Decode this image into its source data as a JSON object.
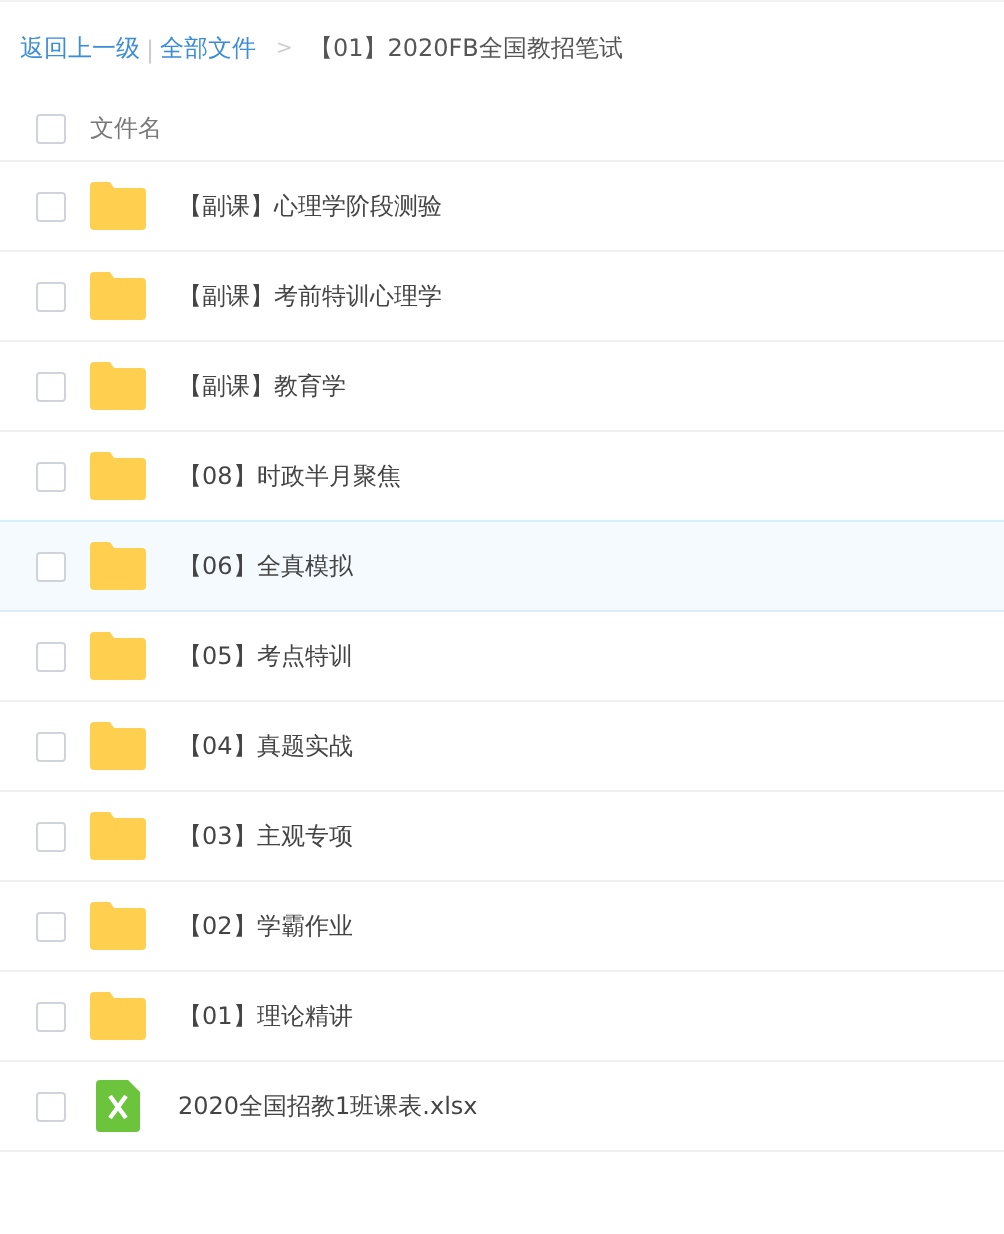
{
  "breadcrumb": {
    "back": "返回上一级",
    "separator": "|",
    "root": "全部文件",
    "arrow": ">",
    "current": "【01】2020FB全国教招笔试"
  },
  "header": {
    "label": "文件名",
    "checked": false
  },
  "files": [
    {
      "kind": "folder",
      "name": "【副课】心理学阶段测验",
      "checked": false,
      "hovered": false
    },
    {
      "kind": "folder",
      "name": "【副课】考前特训心理学",
      "checked": false,
      "hovered": false
    },
    {
      "kind": "folder",
      "name": "【副课】教育学",
      "checked": false,
      "hovered": false
    },
    {
      "kind": "folder",
      "name": "【08】时政半月聚焦",
      "checked": false,
      "hovered": false
    },
    {
      "kind": "folder",
      "name": "【06】全真模拟",
      "checked": false,
      "hovered": true
    },
    {
      "kind": "folder",
      "name": "【05】考点特训",
      "checked": false,
      "hovered": false
    },
    {
      "kind": "folder",
      "name": "【04】真题实战",
      "checked": false,
      "hovered": false
    },
    {
      "kind": "folder",
      "name": "【03】主观专项",
      "checked": false,
      "hovered": false
    },
    {
      "kind": "folder",
      "name": "【02】学霸作业",
      "checked": false,
      "hovered": false
    },
    {
      "kind": "folder",
      "name": "【01】理论精讲",
      "checked": false,
      "hovered": false
    },
    {
      "kind": "excel",
      "name": "2020全国招教1班课表.xlsx",
      "checked": false,
      "hovered": false
    }
  ]
}
